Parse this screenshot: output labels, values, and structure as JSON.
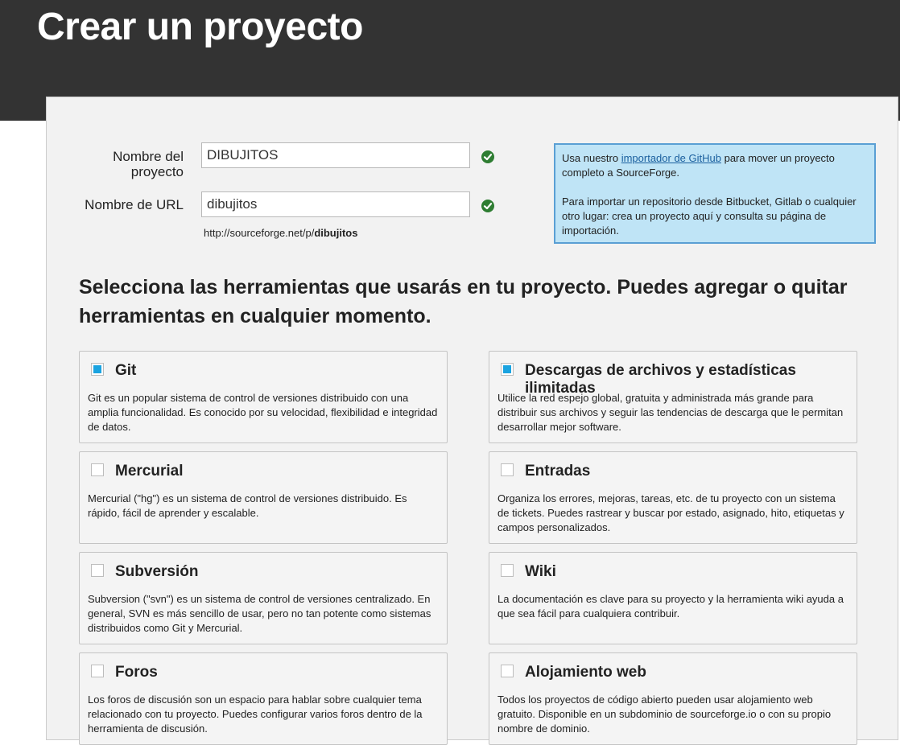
{
  "page": {
    "title": "Crear un proyecto"
  },
  "form": {
    "name_label": "Nombre del proyecto",
    "name_value": "DIBUJITOS",
    "url_label": "Nombre de URL",
    "url_value": "dibujitos",
    "url_prefix": "http://sourceforge.net/p/",
    "url_slug": "dibujitos"
  },
  "info": {
    "p1_before": "Usa nuestro ",
    "p1_link": "importador de GitHub",
    "p1_after": " para mover un proyecto completo a SourceForge.",
    "p2": "Para importar un repositorio desde Bitbucket, Gitlab o cualquier otro lugar: crea un proyecto aquí y consulta su página de importación."
  },
  "tools_heading": "Selecciona las herramientas que usarás en tu proyecto. Puedes agregar o quitar herramientas en cualquier momento.",
  "tools": [
    {
      "title": "Git",
      "checked": true,
      "desc": "Git es un popular sistema de control de versiones distribuido con una amplia funcionalidad. Es conocido por su velocidad, flexibilidad e integridad de datos."
    },
    {
      "title": "Descargas de archivos y estadísticas ilimitadas",
      "checked": true,
      "desc": "Utilice la red espejo global, gratuita y administrada más grande para distribuir sus archivos y seguir las tendencias de descarga que le permitan desarrollar mejor software."
    },
    {
      "title": "Mercurial",
      "checked": false,
      "desc": "Mercurial (\"hg\") es un sistema de control de versiones distribuido. Es rápido, fácil de aprender y escalable."
    },
    {
      "title": "Entradas",
      "checked": false,
      "desc": "Organiza los errores, mejoras, tareas, etc. de tu proyecto con un sistema de tickets. Puedes rastrear y buscar por estado, asignado, hito, etiquetas y campos personalizados."
    },
    {
      "title": "Subversión",
      "checked": false,
      "desc": "Subversion (\"svn\") es un sistema de control de versiones centralizado. En general, SVN es más sencillo de usar, pero no tan potente como sistemas distribuidos como Git y Mercurial."
    },
    {
      "title": "Wiki",
      "checked": false,
      "desc": "La documentación es clave para su proyecto y la herramienta wiki ayuda a que sea fácil para cualquiera contribuir."
    },
    {
      "title": "Foros",
      "checked": false,
      "desc": "Los foros de discusión son un espacio para hablar sobre cualquier tema relacionado con tu proyecto. Puedes configurar varios foros dentro de la herramienta de discusión."
    },
    {
      "title": "Alojamiento web",
      "checked": false,
      "desc": "Todos los proyectos de código abierto pueden usar alojamiento web gratuito. Disponible en un subdominio de sourceforge.io o con su propio nombre de dominio."
    }
  ]
}
